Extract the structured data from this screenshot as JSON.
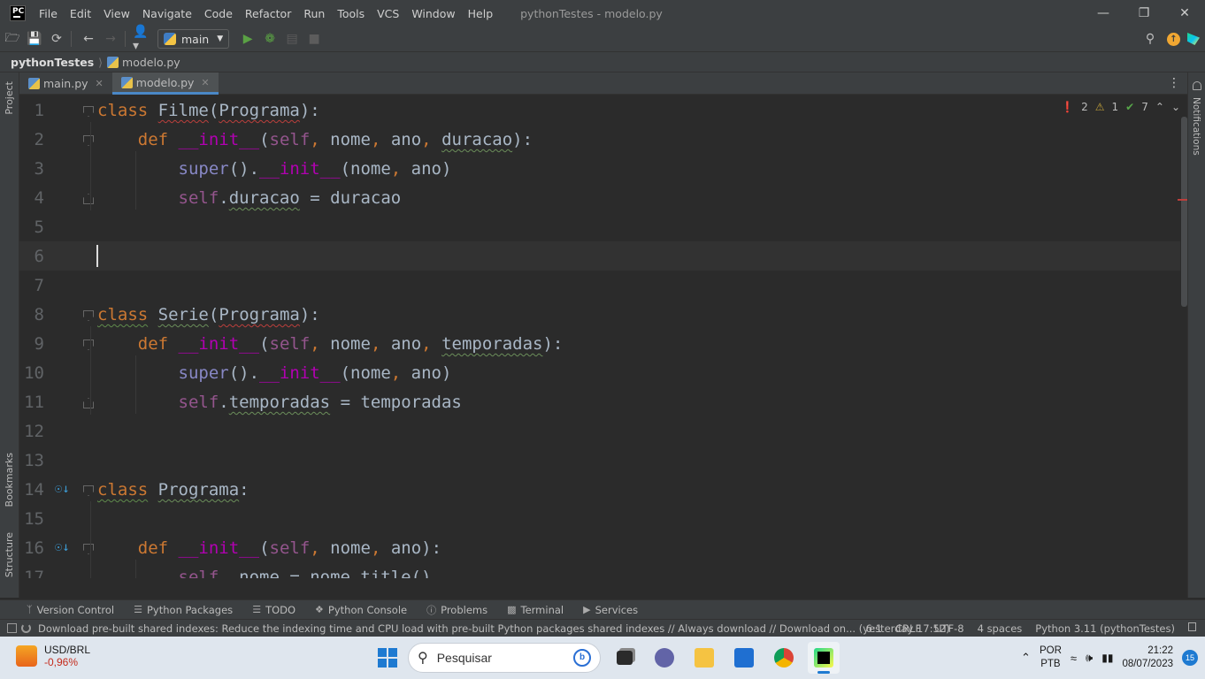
{
  "window": {
    "app_logo": "PC",
    "menu": [
      "File",
      "Edit",
      "View",
      "Navigate",
      "Code",
      "Refactor",
      "Run",
      "Tools",
      "VCS",
      "Window",
      "Help"
    ],
    "title": "pythonTestes - modelo.py"
  },
  "toolbar": {
    "branch": "main"
  },
  "breadcrumb": {
    "project": "pythonTestes",
    "file": "modelo.py"
  },
  "side_panels": {
    "left": [
      "Project",
      "Bookmarks",
      "Structure"
    ],
    "right": [
      "Notifications"
    ]
  },
  "tabs": [
    {
      "label": "main.py",
      "active": false
    },
    {
      "label": "modelo.py",
      "active": true
    }
  ],
  "inspections": {
    "errors": "2",
    "warnings": "1",
    "weak_warnings": "7"
  },
  "code": {
    "line_numbers": [
      "1",
      "2",
      "3",
      "4",
      "5",
      "6",
      "7",
      "8",
      "9",
      "10",
      "11",
      "12",
      "13",
      "14",
      "15",
      "16",
      "17"
    ],
    "caret_line": 6
  },
  "tool_windows": [
    "Version Control",
    "Python Packages",
    "TODO",
    "Python Console",
    "Problems",
    "Terminal",
    "Services"
  ],
  "status": {
    "message": "Download pre-built shared indexes: Reduce the indexing time and CPU load with pre-built Python packages shared indexes // Always download // Download on... (yesterday 17:52)",
    "position": "6:1",
    "line_sep": "CRLF",
    "encoding": "UTF-8",
    "indent": "4 spaces",
    "interpreter": "Python 3.11 (pythonTestes)"
  },
  "taskbar": {
    "widget_title": "USD/BRL",
    "widget_value": "-0,96%",
    "search_placeholder": "Pesquisar",
    "lang_1": "POR",
    "lang_2": "PTB",
    "time": "21:22",
    "date": "08/07/2023",
    "notifications": "15"
  },
  "colors": {
    "keyword": "#cc7832",
    "self": "#94558d",
    "dunder": "#b200b2",
    "builtin": "#8888c6",
    "text": "#a9b7c6",
    "accent": "#4a88c7"
  }
}
